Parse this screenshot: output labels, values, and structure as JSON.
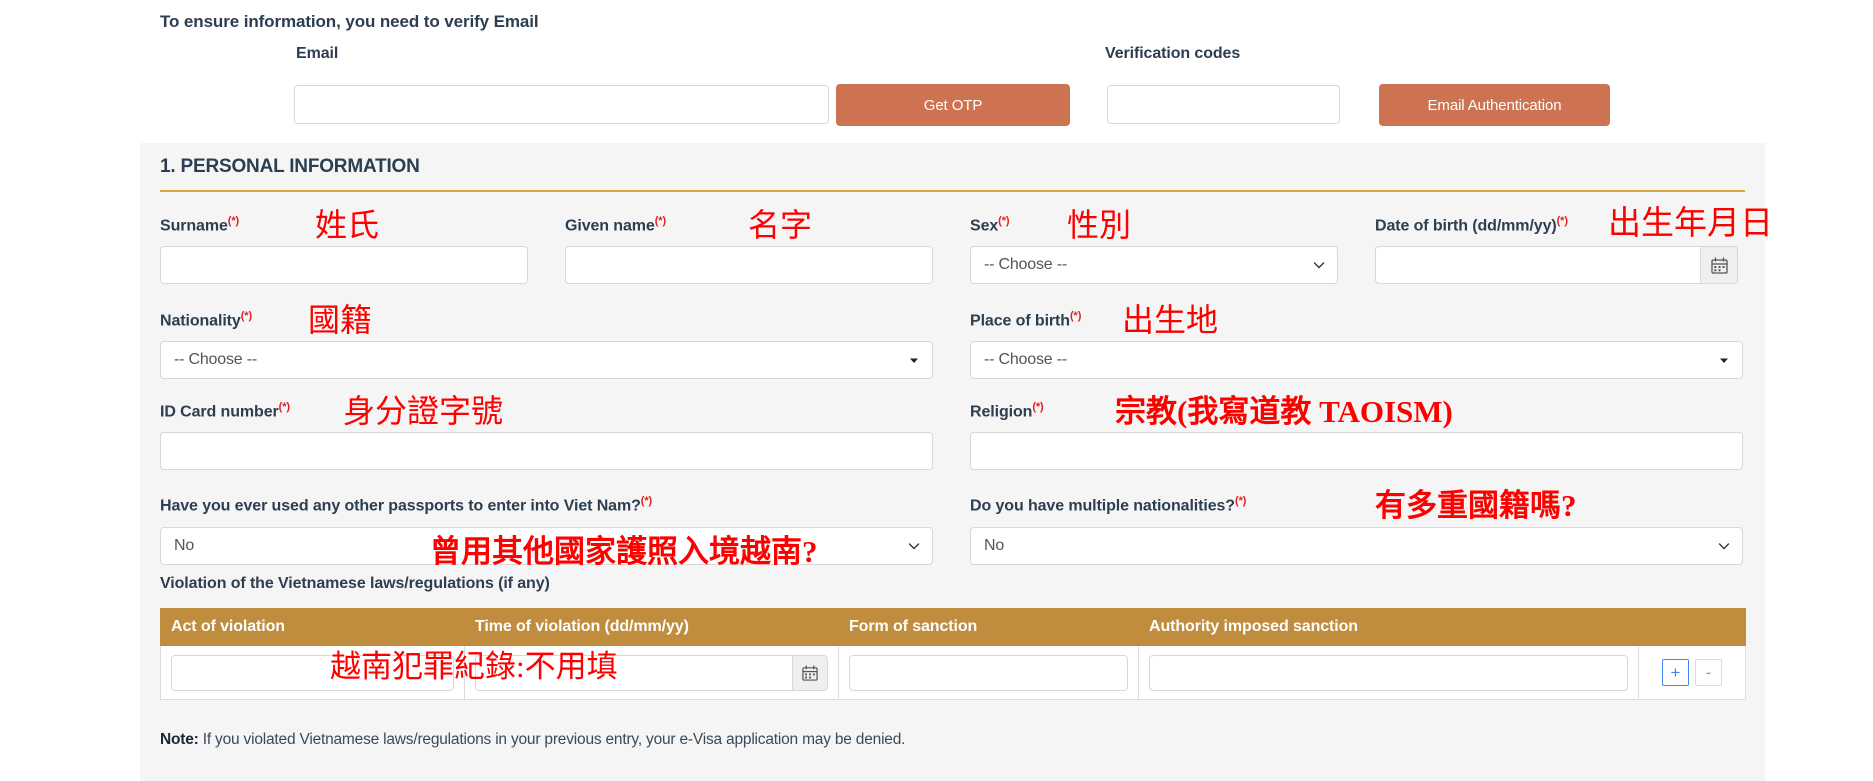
{
  "verify": {
    "instruction": "To ensure information, you need to verify Email",
    "email_label": "Email",
    "email_value": "",
    "get_otp_label": "Get OTP",
    "verification_codes_label": "Verification codes",
    "verification_codes_value": "",
    "email_auth_label": "Email Authentication"
  },
  "section": {
    "title": "1. PERSONAL INFORMATION",
    "accent_color": "#e5a13f",
    "button_color": "#cd7351",
    "table_header_color": "#c08c3d",
    "annotation_color": "#ff0000"
  },
  "fields": {
    "surname": {
      "label": "Surname",
      "required": "(*)",
      "annotation": "姓氏",
      "value": ""
    },
    "given_name": {
      "label": "Given name",
      "required": "(*)",
      "annotation": "名字",
      "value": ""
    },
    "sex": {
      "label": "Sex",
      "required": "(*)",
      "annotation": "性別",
      "value": "-- Choose --"
    },
    "date_of_birth": {
      "label": "Date of birth (dd/mm/yy)",
      "required": "(*)",
      "annotation": "出生年月日",
      "value": ""
    },
    "nationality": {
      "label": "Nationality",
      "required": "(*)",
      "annotation": "國籍",
      "value": "-- Choose --"
    },
    "place_of_birth": {
      "label": "Place of birth",
      "required": "(*)",
      "annotation": "出生地",
      "value": "-- Choose --"
    },
    "id_card_number": {
      "label": "ID Card number",
      "required": "(*)",
      "annotation": "身分證字號",
      "value": ""
    },
    "religion": {
      "label": "Religion",
      "required": "(*)",
      "annotation": "宗教(我寫道教 TAOISM)",
      "value": ""
    },
    "other_passports": {
      "label": "Have you ever used any other passports to enter into Viet Nam?",
      "required": "(*)",
      "annotation": "曾用其他國家護照入境越南?",
      "value": "No"
    },
    "multiple_nationalities": {
      "label": "Do you have multiple nationalities?",
      "required": "(*)",
      "annotation": "有多重國籍嗎?",
      "value": "No"
    }
  },
  "violation": {
    "label": "Violation of the Vietnamese laws/regulations (if any)",
    "columns": [
      "Act of violation",
      "Time of violation (dd/mm/yy)",
      "Form of sanction",
      "Authority imposed sanction"
    ],
    "rows": [
      {
        "act": "",
        "time": "",
        "form": "",
        "authority": ""
      }
    ],
    "annotation": "越南犯罪紀錄:不用填",
    "add_label": "+",
    "remove_label": "-",
    "note_prefix": "Note:",
    "note_text": "If you violated Vietnamese laws/regulations in your previous entry, your e-Visa application may be denied."
  }
}
